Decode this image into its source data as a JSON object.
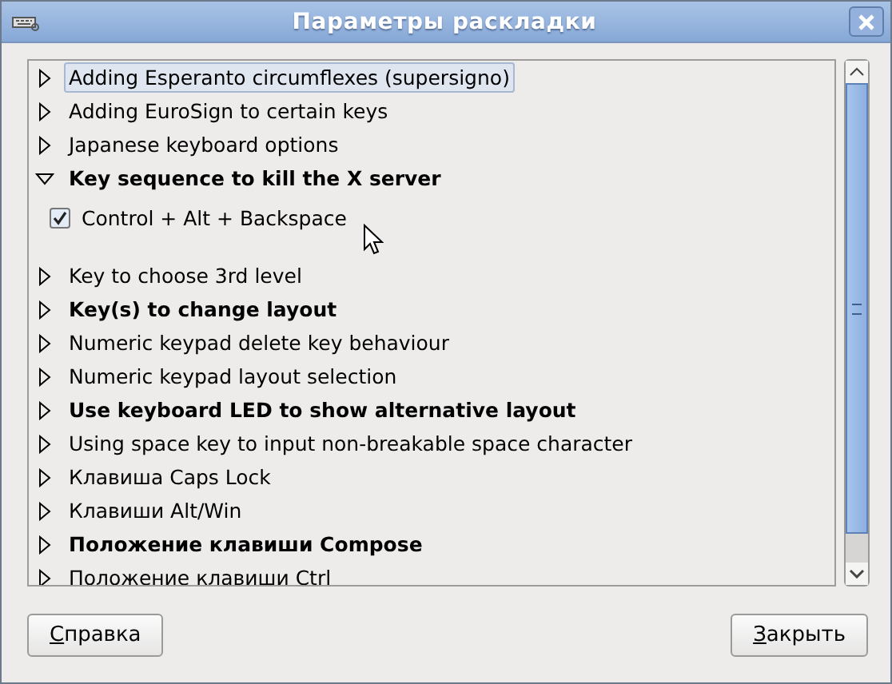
{
  "window": {
    "title": "Параметры раскладки"
  },
  "options": [
    {
      "label": "Adding Esperanto circumflexes (supersigno)",
      "bold": false,
      "expanded": false,
      "selected": true
    },
    {
      "label": "Adding EuroSign to certain keys",
      "bold": false,
      "expanded": false,
      "selected": false
    },
    {
      "label": "Japanese keyboard options",
      "bold": false,
      "expanded": false,
      "selected": false
    },
    {
      "label": "Key sequence to kill the X server",
      "bold": true,
      "expanded": true,
      "selected": false,
      "children": [
        {
          "label": "Control + Alt + Backspace",
          "checked": true
        }
      ]
    },
    {
      "label": "Key to choose 3rd level",
      "bold": false,
      "expanded": false,
      "selected": false
    },
    {
      "label": "Key(s) to change layout",
      "bold": true,
      "expanded": false,
      "selected": false
    },
    {
      "label": "Numeric keypad delete key behaviour",
      "bold": false,
      "expanded": false,
      "selected": false
    },
    {
      "label": "Numeric keypad layout selection",
      "bold": false,
      "expanded": false,
      "selected": false
    },
    {
      "label": "Use keyboard LED to show alternative layout",
      "bold": true,
      "expanded": false,
      "selected": false
    },
    {
      "label": "Using space key to input non-breakable space character",
      "bold": false,
      "expanded": false,
      "selected": false
    },
    {
      "label": "Клавиша Caps Lock",
      "bold": false,
      "expanded": false,
      "selected": false
    },
    {
      "label": "Клавиши Alt/Win",
      "bold": false,
      "expanded": false,
      "selected": false
    },
    {
      "label": "Положение клавиши Compose",
      "bold": true,
      "expanded": false,
      "selected": false
    },
    {
      "label": "Положение клавиши Ctrl",
      "bold": false,
      "expanded": false,
      "selected": false
    }
  ],
  "buttons": [
    {
      "label": "Справка"
    },
    {
      "label": "Закрыть"
    }
  ]
}
